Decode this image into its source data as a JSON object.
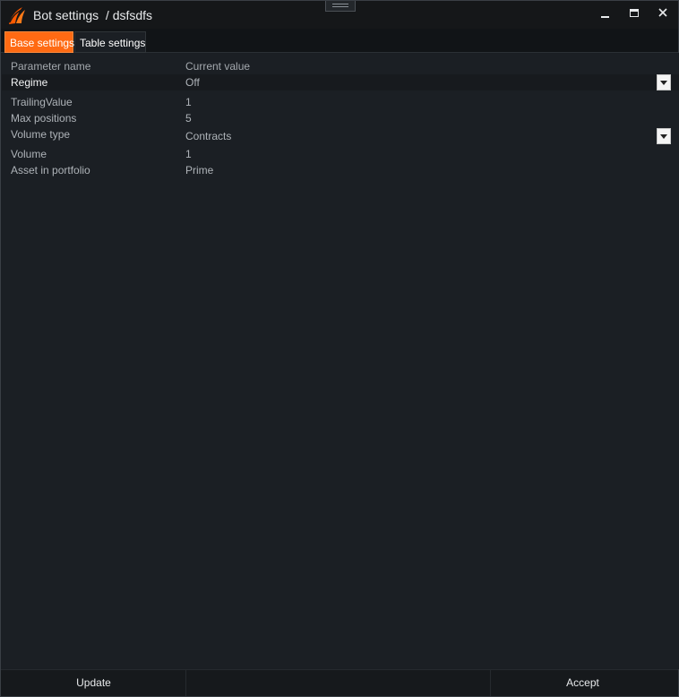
{
  "window": {
    "title": "Bot settings  / dsfsdfs",
    "minimize_glyph": "▁",
    "maximize_glyph": "■",
    "close_glyph": "✕",
    "accent_color": "#ff6a13"
  },
  "tabs": [
    {
      "label": "Base settings",
      "active": true
    },
    {
      "label": "Table settings",
      "active": false
    }
  ],
  "grid": {
    "headers": {
      "name": "Parameter name",
      "value": "Current value"
    },
    "rows": [
      {
        "name": "Regime",
        "value": "Off",
        "type": "dropdown"
      },
      {
        "name": "TrailingValue",
        "value": "1",
        "type": "text"
      },
      {
        "name": "Max positions",
        "value": "5",
        "type": "text"
      },
      {
        "name": "Volume type",
        "value": "Contracts",
        "type": "dropdown"
      },
      {
        "name": "Volume",
        "value": "1",
        "type": "text"
      },
      {
        "name": "Asset in portfolio",
        "value": "Prime",
        "type": "text"
      }
    ]
  },
  "footer": {
    "update_label": "Update",
    "accept_label": "Accept"
  }
}
